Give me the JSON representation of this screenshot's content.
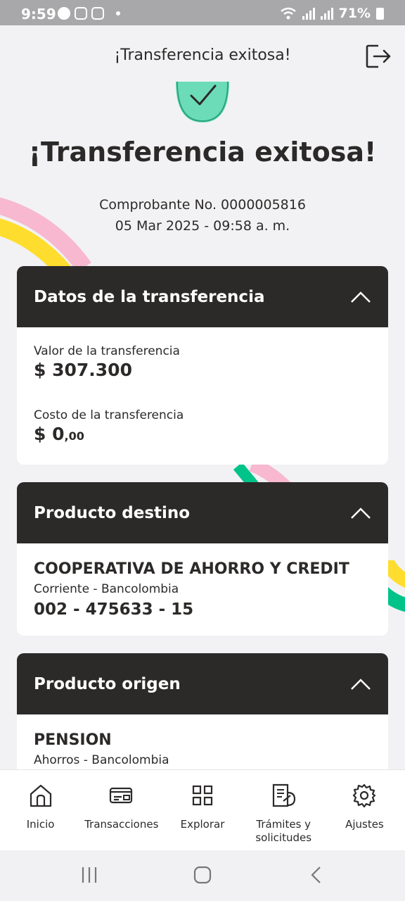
{
  "status_bar": {
    "time": "9:59",
    "battery": "71%"
  },
  "header": {
    "title": "¡Transferencia exitosa!",
    "exit_icon": "logout-icon"
  },
  "success": {
    "icon": "check-icon",
    "accent_color": "#6cdcb8",
    "title": "¡Transferencia exitosa!",
    "receipt": "Comprobante No. 0000005816",
    "datetime": "05 Mar 2025 - 09:58 a. m."
  },
  "transfer_card": {
    "title": "Datos de la transferencia",
    "value_label": "Valor de la transferencia",
    "value": "$ 307.300",
    "cost_label": "Costo de la transferencia",
    "cost_main": "$ 0",
    "cost_decimals": ",00"
  },
  "destination_card": {
    "title": "Producto destino",
    "name": "COOPERATIVA DE AHORRO Y CREDIT",
    "type": "Corriente - Bancolombia",
    "number": "002 - 475633 - 15"
  },
  "origin_card": {
    "title": "Producto origen",
    "name": "PENSION",
    "type": "Ahorros - Bancolombia"
  },
  "bottom_nav": {
    "items": [
      {
        "label": "Inicio",
        "icon": "home-icon"
      },
      {
        "label": "Transacciones",
        "icon": "card-icon"
      },
      {
        "label": "Explorar",
        "icon": "grid-icon"
      },
      {
        "label": "Trámites y solicitudes",
        "icon": "document-icon"
      },
      {
        "label": "Ajustes",
        "icon": "gear-icon"
      }
    ]
  },
  "colors": {
    "dark": "#2c2a29",
    "background": "#f2f2f4",
    "ribbon_pink": "#f7b8d0",
    "ribbon_yellow": "#ffdd2e",
    "ribbon_green": "#00c389"
  }
}
